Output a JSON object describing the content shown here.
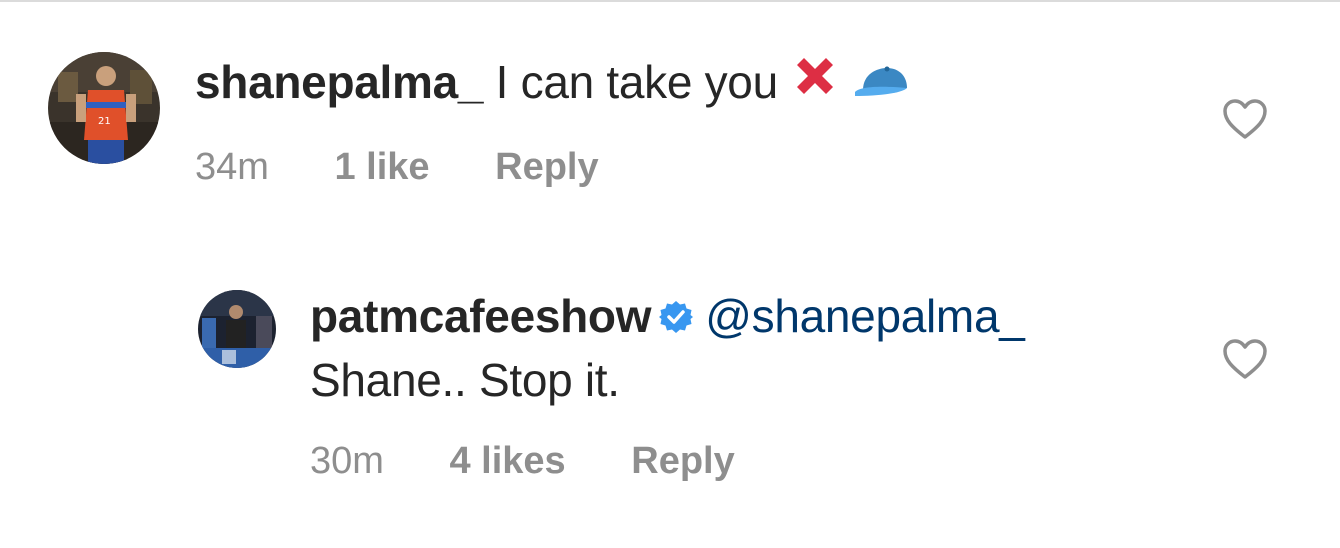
{
  "comments": [
    {
      "username": "shanepalma_",
      "text": "I can take you",
      "time": "34m",
      "likes": "1 like",
      "reply": "Reply",
      "emojis": [
        "cross-mark-icon",
        "blue-cap-icon"
      ]
    },
    {
      "username": "patmcafeeshow",
      "verified": true,
      "mention": "@shanepalma_",
      "text": "Shane.. Stop it.",
      "time": "30m",
      "likes": "4 likes",
      "reply": "Reply"
    }
  ],
  "colors": {
    "text": "#262626",
    "muted": "#8e8e8e",
    "mention": "#00376b",
    "verified": "#3897f0",
    "cross": "#dd2e44",
    "cap": "#3b88c3"
  }
}
